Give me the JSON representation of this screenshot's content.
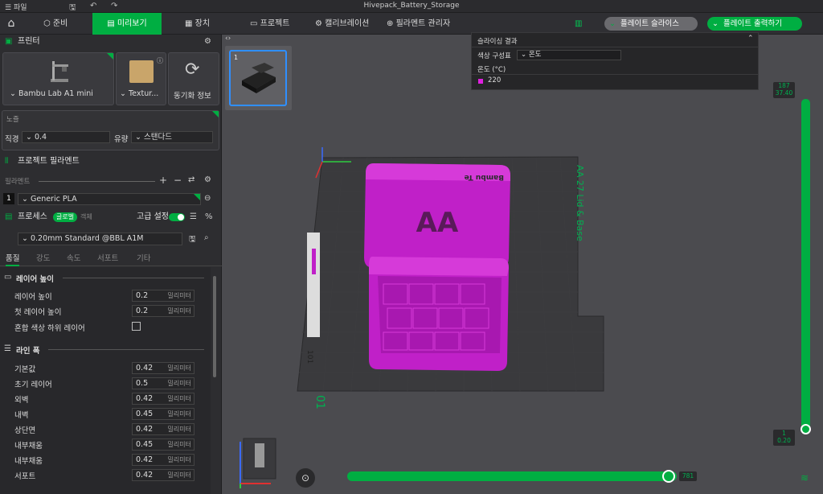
{
  "window": {
    "title": "Hivepack_Battery_Storage",
    "menu": "파일"
  },
  "topbar": {
    "tabs": [
      "준비",
      "미리보기",
      "장치",
      "프로젝트",
      "캘리브레이션",
      "필라멘트 관리자"
    ],
    "slice_label": "플레이트 슬라이스",
    "print_label": "플레이트 출력하기"
  },
  "printer": {
    "header": "프린터",
    "name": "Bambu Lab A1 mini",
    "plate": "Textur...",
    "sync_label": "동기화 정보",
    "nozzle_header": "노즐",
    "diameter_label": "직경",
    "diameter": "0.4",
    "flow_label": "유량",
    "flow": "스탠다드"
  },
  "filament": {
    "header": "프로젝트 필라멘트",
    "sub": "필라멘트",
    "slot": "1",
    "name": "Generic PLA"
  },
  "process": {
    "header": "프로세스",
    "global": "글로벌",
    "object": "객체",
    "advanced": "고급 설정",
    "preset": "0.20mm Standard @BBL A1M",
    "tabs": [
      "품질",
      "강도",
      "속도",
      "서포트",
      "기타"
    ]
  },
  "layer_height": {
    "header": "레이어 높이",
    "rows": [
      {
        "label": "레이어 높이",
        "value": "0.2",
        "unit": "밀리미터"
      },
      {
        "label": "첫 레이어 높이",
        "value": "0.2",
        "unit": "밀리미터"
      }
    ],
    "mixed": "혼합 색상 하위 레이어"
  },
  "line_width": {
    "header": "라인 폭",
    "rows": [
      {
        "label": "기본값",
        "value": "0.42",
        "unit": "밀리미터"
      },
      {
        "label": "초기 레이어",
        "value": "0.5",
        "unit": "밀리미터"
      },
      {
        "label": "외벽",
        "value": "0.42",
        "unit": "밀리미터"
      },
      {
        "label": "내벽",
        "value": "0.45",
        "unit": "밀리미터"
      },
      {
        "label": "상단면",
        "value": "0.42",
        "unit": "밀리미터"
      },
      {
        "label": "내부채움",
        "value": "0.45",
        "unit": "밀리미터"
      },
      {
        "label": "내부채움",
        "value": "0.42",
        "unit": "밀리미터"
      },
      {
        "label": "서포트",
        "value": "0.42",
        "unit": "밀리미터"
      }
    ]
  },
  "slice_result": {
    "title": "슬라이싱 결과",
    "scheme_label": "색상 구성표",
    "scheme": "온도",
    "temp_label": "온도 (°C)",
    "temp": "220"
  },
  "viewport": {
    "plate_num": "1",
    "bed_label": "Bambu Te",
    "side_text": "AA 27 Lid & Base",
    "lid_text": "AA",
    "plate_number": "01",
    "small_label": "101",
    "layer_top": "187",
    "layer_top_h": "37.40",
    "layer_bottom": "1",
    "layer_bottom_h": "0.20",
    "move_value": "781",
    "colors": {
      "accent": "#00ae42",
      "model": "#c020c8"
    }
  }
}
